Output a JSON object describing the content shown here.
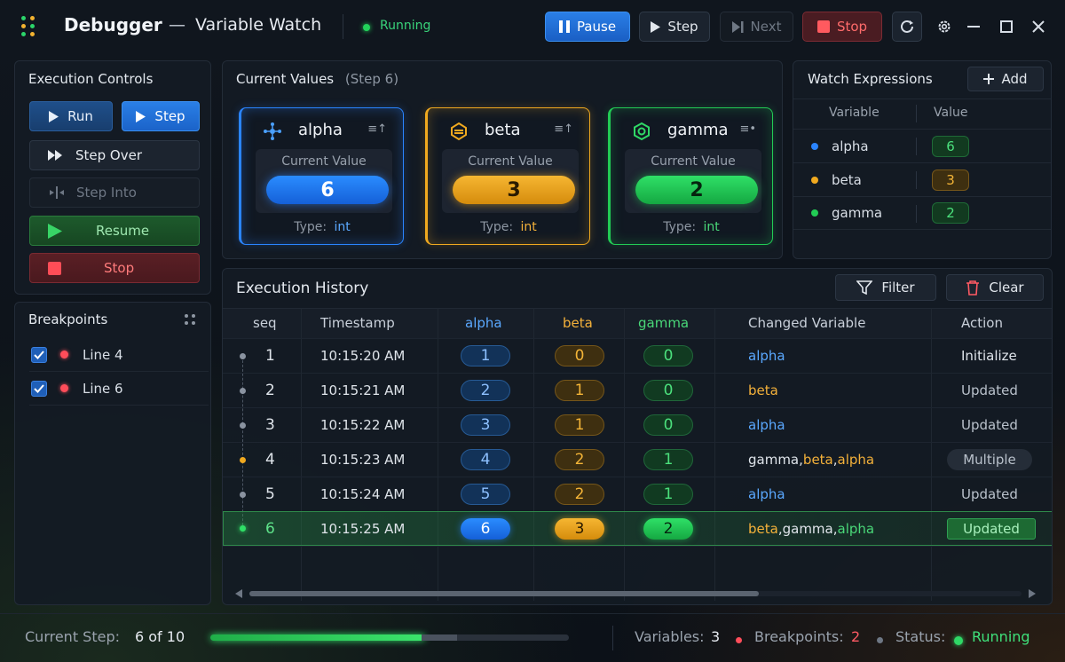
{
  "app": {
    "title": "Debugger",
    "dash": "—",
    "subtitle": "Variable Watch",
    "status": "Running"
  },
  "toolbar": {
    "pause": "Pause",
    "step": "Step",
    "next": "Next",
    "stop": "Stop"
  },
  "controls": {
    "title": "Execution Controls",
    "run": "Run",
    "step": "Step",
    "step_over": "Step Over",
    "step_into": "Step Into",
    "resume": "Resume",
    "stop": "Stop"
  },
  "breakpoints": {
    "title": "Breakpoints",
    "items": [
      {
        "label": "Line 4",
        "checked": true
      },
      {
        "label": "Line 6",
        "checked": true
      }
    ]
  },
  "current": {
    "title": "Current Values",
    "step_note": "(Step 6)",
    "label": "Current Value",
    "type_label": "Type:",
    "cards": [
      {
        "name": "alpha",
        "value": "6",
        "type": "int",
        "color": "#2a84ff"
      },
      {
        "name": "beta",
        "value": "3",
        "type": "int",
        "color": "#f0a91f"
      },
      {
        "name": "gamma",
        "value": "2",
        "type": "int",
        "color": "#22cc55"
      }
    ]
  },
  "watch": {
    "title": "Watch Expressions",
    "add": "Add",
    "col_variable": "Variable",
    "col_value": "Value",
    "rows": [
      {
        "name": "alpha",
        "value": "6"
      },
      {
        "name": "beta",
        "value": "3"
      },
      {
        "name": "gamma",
        "value": "2"
      }
    ]
  },
  "history": {
    "title": "Execution History",
    "filter": "Filter",
    "clear": "Clear",
    "columns": [
      "seq",
      "Timestamp",
      "alpha",
      "beta",
      "gamma",
      "Changed Variable",
      "Action"
    ],
    "rows": [
      {
        "seq": "1",
        "ts": "10:15:20 AM",
        "a": "1",
        "b": "0",
        "g": "0",
        "action": "Initialize"
      },
      {
        "seq": "2",
        "ts": "10:15:21 AM",
        "a": "2",
        "b": "1",
        "g": "0",
        "action": "Updated"
      },
      {
        "seq": "3",
        "ts": "10:15:22 AM",
        "a": "3",
        "b": "1",
        "g": "0",
        "action": "Updated"
      },
      {
        "seq": "4",
        "ts": "10:15:23 AM",
        "a": "4",
        "b": "2",
        "g": "1",
        "action": "Multiple"
      },
      {
        "seq": "5",
        "ts": "10:15:24 AM",
        "a": "5",
        "b": "2",
        "g": "1",
        "action": "Updated"
      },
      {
        "seq": "6",
        "ts": "10:15:25 AM",
        "a": "6",
        "b": "3",
        "g": "2",
        "action": "Updated"
      }
    ],
    "changed": {
      "r1": "alpha",
      "r2": "beta",
      "r3": "alpha",
      "r5": "alpha",
      "r4a": "gamma",
      "r4b": "beta",
      "r4c": "alpha",
      "r6a": "beta",
      "r6b": "gamma",
      "r6c": "alpha",
      "comma": ", "
    }
  },
  "status": {
    "step_label": "Current Step:",
    "step_value": "6 of 10",
    "progress": 0.6,
    "vars_label": "Variables:",
    "vars_value": "3",
    "bp_label": "Breakpoints:",
    "bp_value": "2",
    "status_label": "Status:",
    "status_value": "Running"
  }
}
